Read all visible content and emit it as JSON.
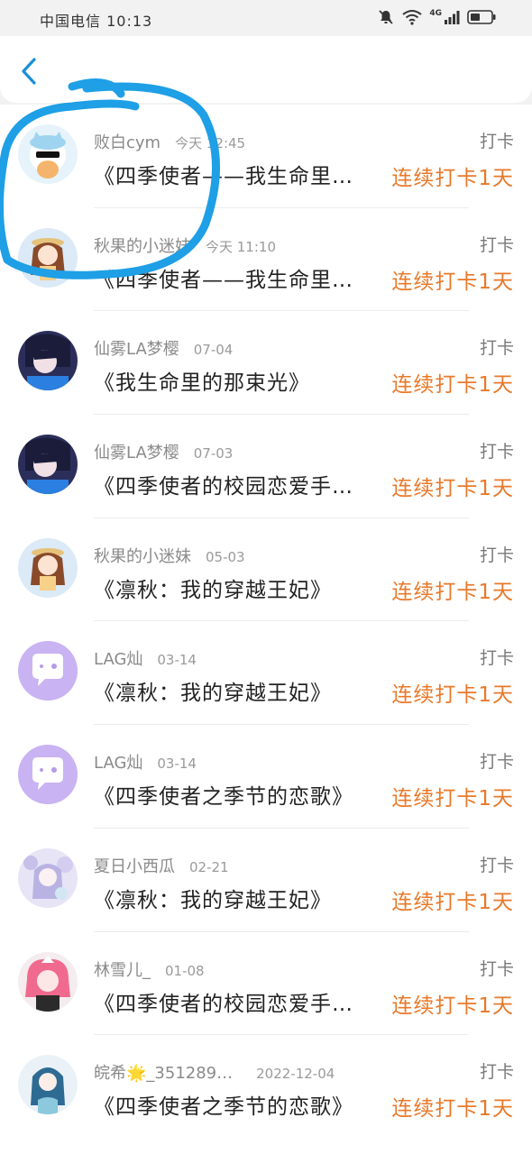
{
  "status_bar": {
    "carrier": "中国电信",
    "time": "10:13",
    "network": "4G"
  },
  "nav": {
    "back_icon": "chevron-left-icon"
  },
  "punch_label": "打卡",
  "colors": {
    "accent": "#e8792a",
    "back": "#1a8fd8",
    "annotation": "#1e9fe6"
  },
  "records": [
    {
      "user": "败白cym",
      "time": "今天 12:45",
      "book": "《四季使者——我生命里…",
      "streak": "连续打卡1天",
      "avatar": "avatar-cat"
    },
    {
      "user": "秋果的小迷妹",
      "time": "今天 11:10",
      "book": "《四季使者——我生命里…",
      "streak": "连续打卡1天",
      "avatar": "avatar-girl-brown"
    },
    {
      "user": "仙雾LA梦樱",
      "time": "07-04",
      "book": "《我生命里的那束光》",
      "streak": "连续打卡1天",
      "avatar": "avatar-dark"
    },
    {
      "user": "仙雾LA梦樱",
      "time": "07-03",
      "book": "《四季使者的校园恋爱手…",
      "streak": "连续打卡1天",
      "avatar": "avatar-dark"
    },
    {
      "user": "秋果的小迷妹",
      "time": "05-03",
      "book": "《凛秋：我的穿越王妃》",
      "streak": "连续打卡1天",
      "avatar": "avatar-girl-brown"
    },
    {
      "user": "LAG灿",
      "time": "03-14",
      "book": "《凛秋：我的穿越王妃》",
      "streak": "连续打卡1天",
      "avatar": "avatar-chat"
    },
    {
      "user": "LAG灿",
      "time": "03-14",
      "book": "《四季使者之季节的恋歌》",
      "streak": "连续打卡1天",
      "avatar": "avatar-chat"
    },
    {
      "user": "夏日小西瓜",
      "time": "02-21",
      "book": "《凛秋：我的穿越王妃》",
      "streak": "连续打卡1天",
      "avatar": "avatar-lilac"
    },
    {
      "user": "林雪儿_",
      "time": "01-08",
      "book": "《四季使者的校园恋爱手…",
      "streak": "连续打卡1天",
      "avatar": "avatar-pink"
    },
    {
      "user": "皖希🌟_351289…",
      "time": "2022-12-04",
      "book": "《四季使者之季节的恋歌》",
      "streak": "连续打卡1天",
      "avatar": "avatar-mermaid"
    }
  ]
}
